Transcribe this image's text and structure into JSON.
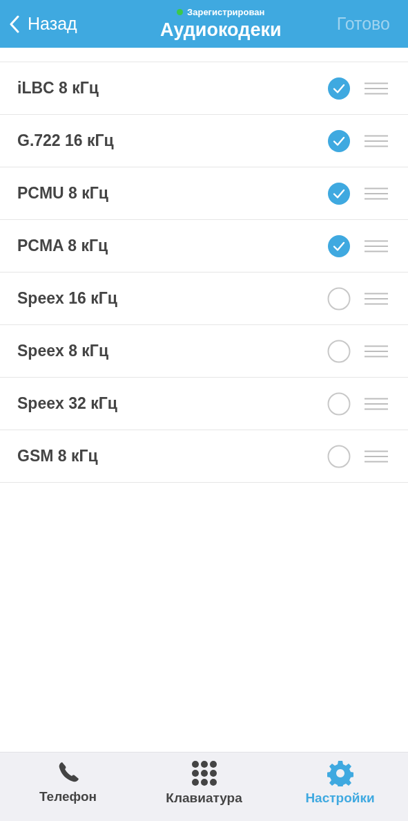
{
  "nav": {
    "back": "Назад",
    "status": {
      "text": "Зарегистрирован",
      "color": "#3cc94a"
    },
    "title": "Аудиокодеки",
    "done": {
      "label": "Готово",
      "disabled": true
    }
  },
  "codecs": [
    {
      "name": "iLBC 8 кГц",
      "checked": true
    },
    {
      "name": "G.722 16 кГц",
      "checked": true
    },
    {
      "name": "PCMU 8 кГц",
      "checked": true
    },
    {
      "name": "PCMA 8 кГц",
      "checked": true
    },
    {
      "name": "Speex 16 кГц",
      "checked": false
    },
    {
      "name": "Speex 8 кГц",
      "checked": false
    },
    {
      "name": "Speex 32 кГц",
      "checked": false
    },
    {
      "name": "GSM 8 кГц",
      "checked": false
    }
  ],
  "tabs": [
    {
      "kind": "phone",
      "label": "Телефон",
      "selected": false
    },
    {
      "kind": "keypad",
      "label": "Клавиатура",
      "selected": false
    },
    {
      "kind": "settings",
      "label": "Настройки",
      "selected": true
    }
  ]
}
